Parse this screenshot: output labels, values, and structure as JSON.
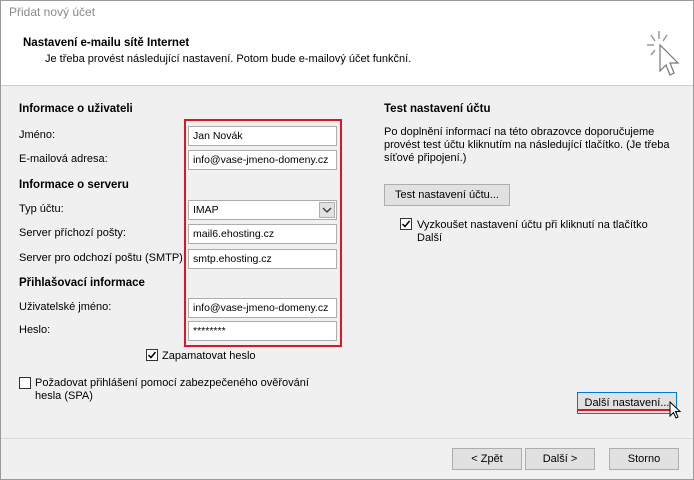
{
  "window": {
    "title": "Přidat nový účet"
  },
  "header": {
    "title": "Nastavení e-mailu sítě Internet",
    "subtitle": "Je třeba provést následující nastavení. Potom bude e-mailový účet funkční."
  },
  "user_info": {
    "section_title": "Informace o uživateli",
    "name_label": "Jméno:",
    "name_value": "Jan Novák",
    "email_label": "E-mailová adresa:",
    "email_value": "info@vase-jmeno-domeny.cz"
  },
  "server_info": {
    "section_title": "Informace o serveru",
    "account_type_label": "Typ účtu:",
    "account_type_value": "IMAP",
    "incoming_label": "Server příchozí pošty:",
    "incoming_value": "mail6.ehosting.cz",
    "outgoing_label": "Server pro odchozí poštu (SMTP):",
    "outgoing_value": "smtp.ehosting.cz"
  },
  "login_info": {
    "section_title": "Přihlašovací informace",
    "username_label": "Uživatelské jméno:",
    "username_value": "info@vase-jmeno-domeny.cz",
    "password_label": "Heslo:",
    "password_value": "********",
    "remember_label": "Zapamatovat heslo",
    "remember_checked": true,
    "spa_label": "Požadovat přihlášení pomocí zabezpečeného ověřování hesla (SPA)",
    "spa_checked": false
  },
  "test": {
    "section_title": "Test nastavení účtu",
    "description": "Po doplnění informací na této obrazovce doporučujeme provést test účtu kliknutím na následující tlačítko. (Je třeba síťové připojení.)",
    "test_button": "Test nastavení účtu...",
    "auto_test_label": "Vyzkoušet nastavení účtu při kliknutí na tlačítko Další",
    "auto_test_checked": true
  },
  "buttons": {
    "more_settings": "Další nastavení...",
    "back": "< Zpět",
    "next": "Další >",
    "cancel": "Storno"
  },
  "colors": {
    "highlight": "#d6192a"
  }
}
